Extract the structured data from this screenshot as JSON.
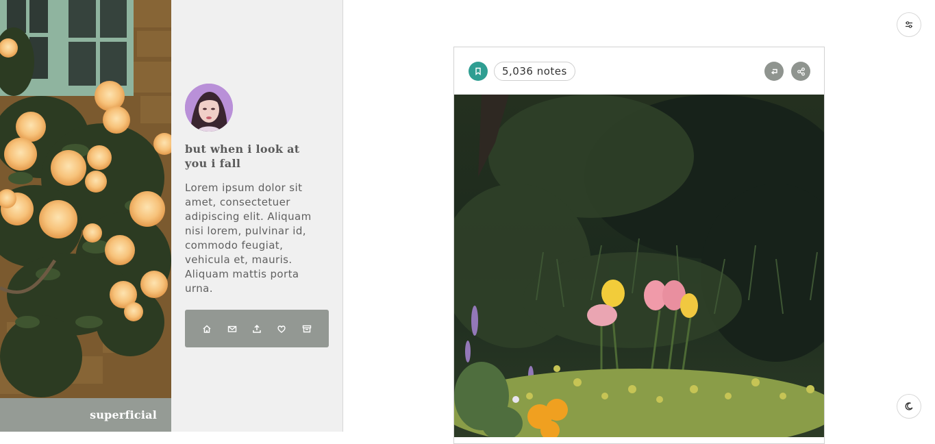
{
  "blog": {
    "name": "superficial",
    "title": "but when i look at you i fall",
    "description": "Lorem ipsum dolor sit amet, consectetuer adipiscing elit. Aliquam nisi lorem, pulvinar id, commodo feugiat, vehicula et, mauris. Aliquam mattis porta urna."
  },
  "nav": {
    "items": [
      {
        "icon": "home-icon"
      },
      {
        "icon": "mail-icon"
      },
      {
        "icon": "upload-icon"
      },
      {
        "icon": "heart-icon"
      },
      {
        "icon": "archive-icon"
      }
    ]
  },
  "post": {
    "notes": "5,036 notes"
  },
  "colors": {
    "accent": "#2f9e92",
    "sidebar_bg": "#f0f0f0",
    "nav_box": "#939893",
    "name_bar": "#959b95"
  }
}
